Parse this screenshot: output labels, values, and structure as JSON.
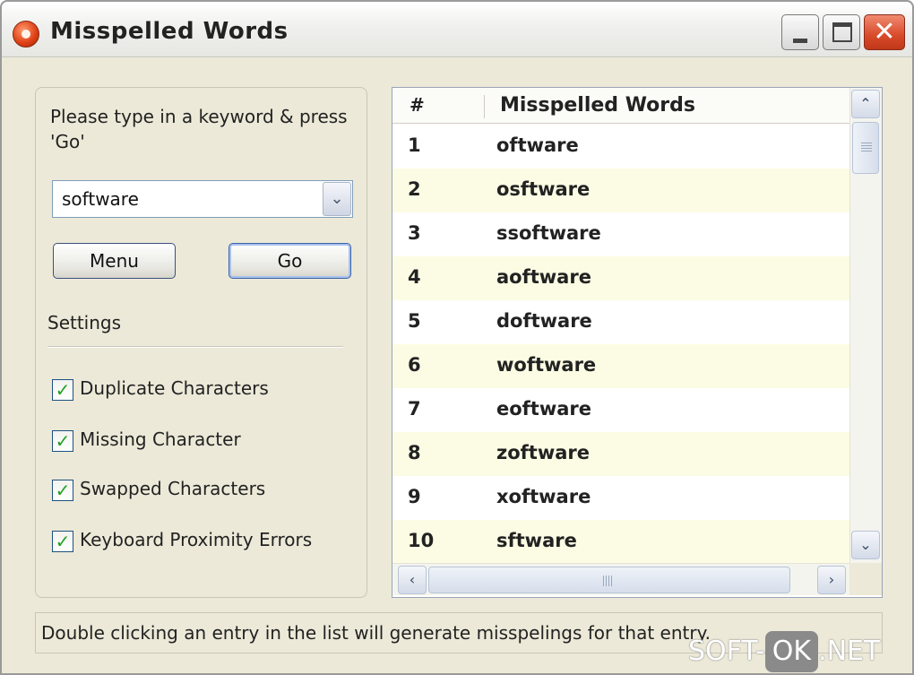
{
  "window": {
    "title": "Misspelled Words",
    "minimize_glyph": "",
    "close_glyph": "✕"
  },
  "left_panel": {
    "prompt": "Please type in a keyword & press 'Go'",
    "keyword_value": "software",
    "dropdown_glyph": "⌄",
    "menu_label": "Menu",
    "go_label": "Go",
    "settings_label": "Settings",
    "options": [
      {
        "label": "Duplicate Characters",
        "checked": true
      },
      {
        "label": "Missing Character",
        "checked": true
      },
      {
        "label": "Swapped Characters",
        "checked": true
      },
      {
        "label": "Keyboard Proximity Errors",
        "checked": true
      }
    ],
    "check_glyph": "✓"
  },
  "list": {
    "columns": [
      "#",
      "Misspelled Words"
    ],
    "rows": [
      {
        "num": "1",
        "word": "oftware"
      },
      {
        "num": "2",
        "word": "osftware"
      },
      {
        "num": "3",
        "word": "ssoftware"
      },
      {
        "num": "4",
        "word": "aoftware"
      },
      {
        "num": "5",
        "word": "doftware"
      },
      {
        "num": "6",
        "word": "woftware"
      },
      {
        "num": "7",
        "word": "eoftware"
      },
      {
        "num": "8",
        "word": "zoftware"
      },
      {
        "num": "9",
        "word": "xoftware"
      },
      {
        "num": "10",
        "word": "sftware"
      }
    ],
    "scroll_up_glyph": "⌃",
    "scroll_down_glyph": "⌄",
    "scroll_left_glyph": "‹",
    "scroll_right_glyph": "›"
  },
  "status": {
    "text": "Double clicking an entry in the list will generate misspelings for that entry."
  },
  "watermark": {
    "prefix": "SOFT-",
    "ok": "OK",
    "suffix": ".NET"
  },
  "colors": {
    "window_bg": "#ece9d8",
    "alt_row": "#fcfce4",
    "check": "#21a121",
    "close_button": "#d84a2a"
  }
}
